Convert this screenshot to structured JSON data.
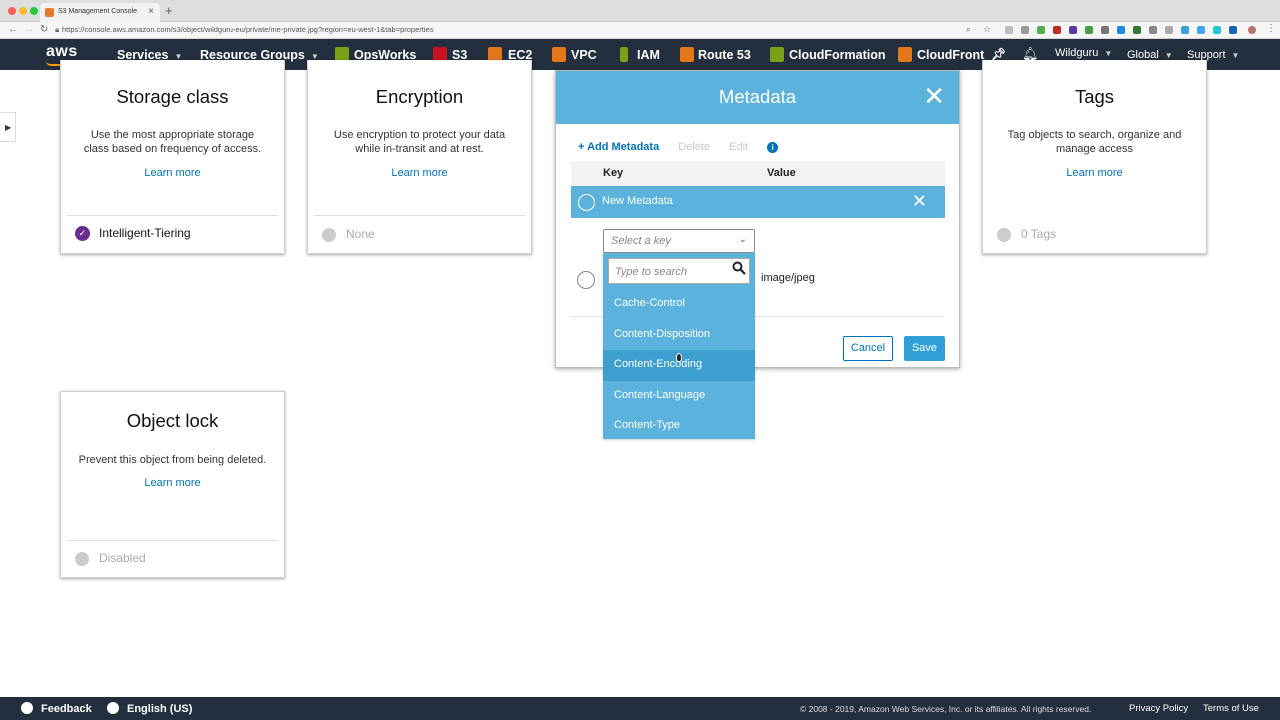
{
  "browser": {
    "tab_title": "S3 Management Console",
    "url": "https://console.aws.amazon.com/s3/object/wildguru-eu/private/me-private.jpg?region=eu-west-1&tab=properties"
  },
  "nav": {
    "logo": "aws",
    "services": "Services",
    "resource_groups": "Resource Groups",
    "shortcuts": [
      "OpsWorks",
      "S3",
      "EC2",
      "VPC",
      "IAM",
      "Route 53",
      "CloudFormation",
      "CloudFront"
    ],
    "user": "Wildguru",
    "region": "Global",
    "support": "Support",
    "colors": {
      "bar": "#232f3e",
      "accent": "#ff9900"
    }
  },
  "cards": {
    "storage": {
      "title": "Storage class",
      "desc": "Use the most appropriate storage class based on frequency of access.",
      "learn": "Learn more",
      "status": "Intelligent-Tiering"
    },
    "encryption": {
      "title": "Encryption",
      "desc": "Use encryption to protect your data while in-transit and at rest.",
      "learn": "Learn more",
      "status": "None"
    },
    "tags": {
      "title": "Tags",
      "desc": "Tag objects to search, organize and manage access",
      "learn": "Learn more",
      "status": "0 Tags"
    },
    "objectlock": {
      "title": "Object lock",
      "desc": "Prevent this object from being deleted.",
      "learn": "Learn more",
      "status": "Disabled"
    }
  },
  "modal": {
    "title": "Metadata",
    "add": "Add Metadata",
    "delete": "Delete",
    "edit": "Edit",
    "col_key": "Key",
    "col_value": "Value",
    "new_row": "New Metadata",
    "select_placeholder": "Select a key",
    "existing_value": "image/jpeg",
    "cancel": "Cancel",
    "save": "Save"
  },
  "dropdown": {
    "search_placeholder": "Type to search",
    "options": [
      "Cache-Control",
      "Content-Disposition",
      "Content-Encoding",
      "Content-Language",
      "Content-Type"
    ],
    "highlighted": "Content-Encoding"
  },
  "footer": {
    "feedback": "Feedback",
    "language": "English (US)",
    "copyright": "© 2008 - 2019, Amazon Web Services, Inc. or its affiliates. All rights reserved.",
    "privacy": "Privacy Policy",
    "terms": "Terms of Use"
  }
}
